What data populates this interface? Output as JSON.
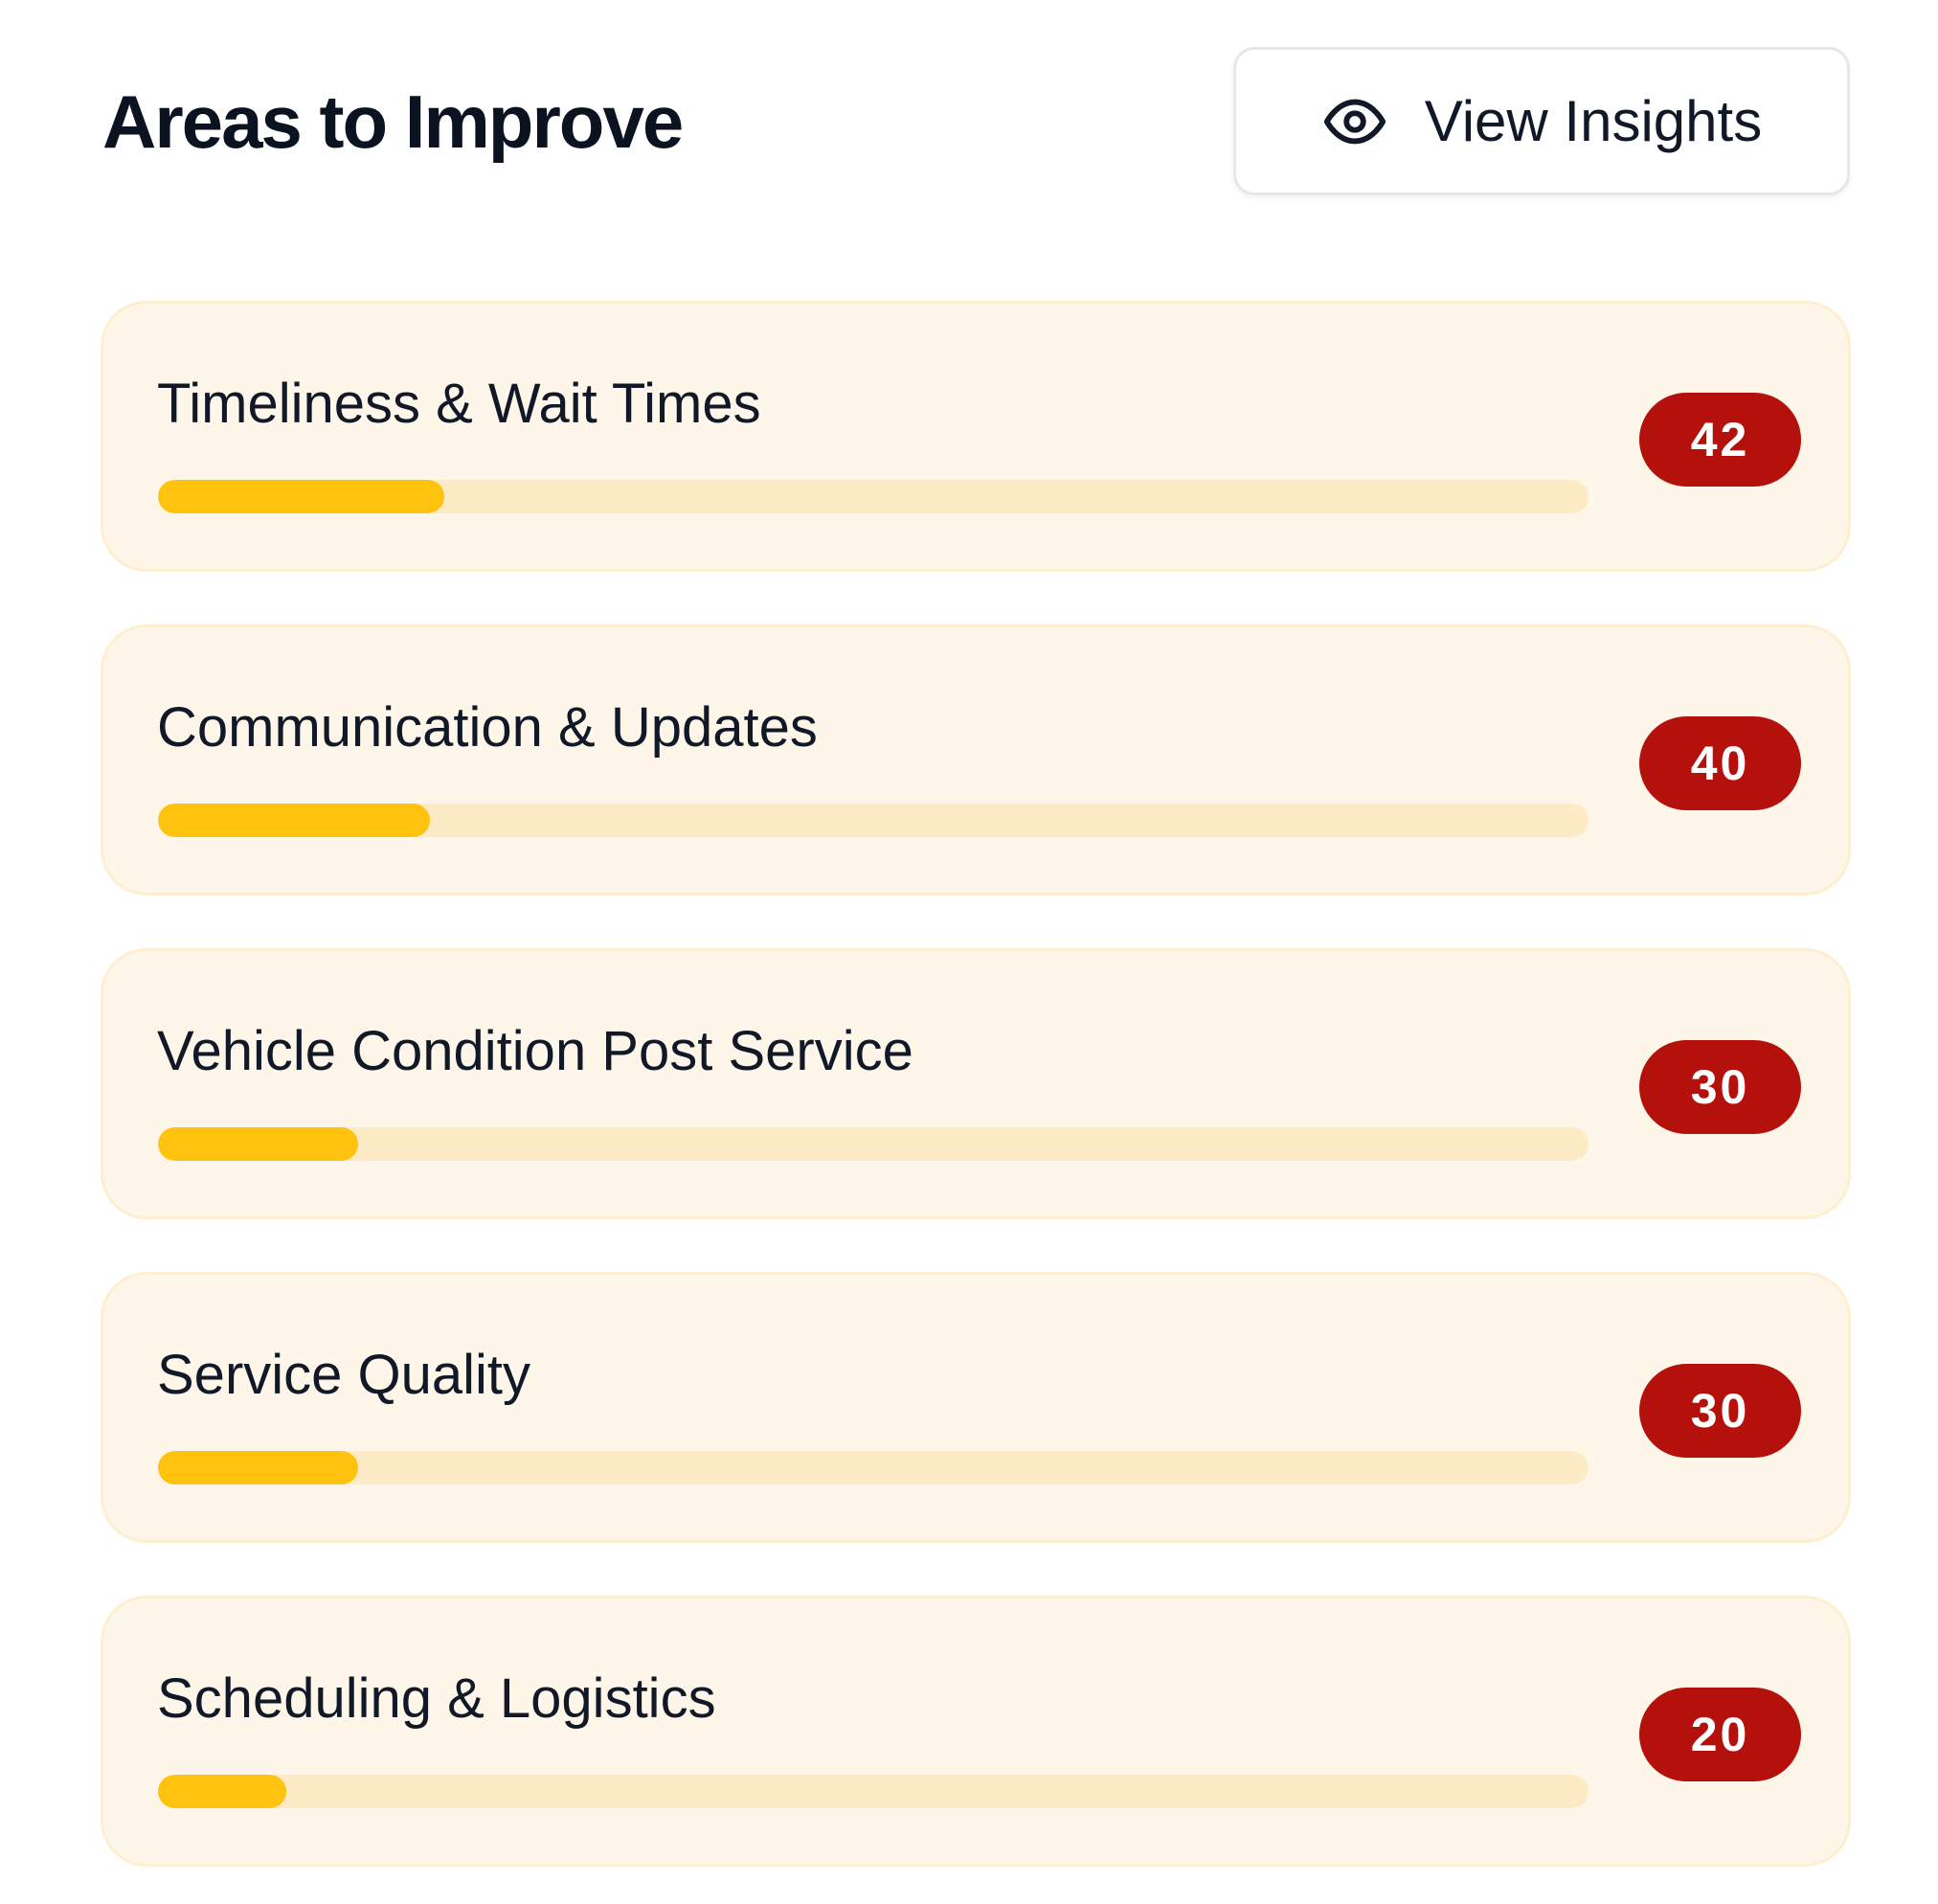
{
  "header": {
    "title": "Areas to Improve",
    "view_insights_label": "View Insights",
    "view_insights_icon": "eye-icon"
  },
  "colors": {
    "card_background": "#fef7e9",
    "progress_fill": "#ffc20e",
    "progress_track": "#fdebc6",
    "badge_background": "#b4100c"
  },
  "items": [
    {
      "label": "Timeliness & Wait Times",
      "count": "42",
      "progress": 0.2
    },
    {
      "label": "Communication & Updates",
      "count": "40",
      "progress": 0.19
    },
    {
      "label": "Vehicle Condition Post Service",
      "count": "30",
      "progress": 0.14
    },
    {
      "label": "Service Quality",
      "count": "30",
      "progress": 0.14
    },
    {
      "label": "Scheduling & Logistics",
      "count": "20",
      "progress": 0.09
    }
  ]
}
